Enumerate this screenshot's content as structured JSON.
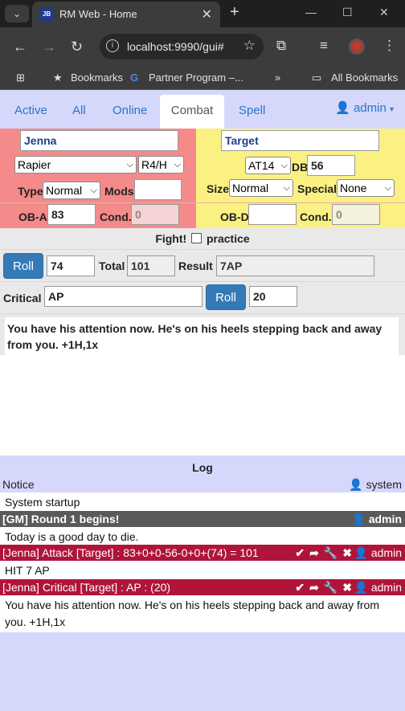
{
  "browser": {
    "tab_title": "RM Web  - Home",
    "favicon_text": "JB",
    "url": "localhost:9990/gui#",
    "bookmarks": [
      "Bookmarks",
      "Partner Program –...",
      "All Bookmarks"
    ]
  },
  "nav": {
    "tabs": [
      "Active",
      "All",
      "Online",
      "Combat",
      "Spell"
    ],
    "active_tab": "Combat",
    "user": "admin"
  },
  "combat": {
    "attacker_name": "Jenna",
    "target_name": "Target",
    "weapon": "Rapier",
    "weapon_mode": "R4/H",
    "armor": "AT14",
    "db_label": "DB",
    "db_value": "56",
    "type_label": "Type",
    "type_value": "Normal",
    "mods_label": "Mods",
    "mods_value": "",
    "size_label": "Size",
    "size_value": "Normal",
    "special_label": "Special",
    "special_value": "None",
    "oba_label": "OB-A",
    "oba_value": "83",
    "cond_label": "Cond.",
    "cond_a_value": "0",
    "obd_label": "OB-D",
    "obd_value": "",
    "cond_d_value": "0",
    "fight_label": "Fight!",
    "practice_label": "practice",
    "roll_label": "Roll",
    "roll_value": "74",
    "total_label": "Total",
    "total_value": "101",
    "result_label": "Result",
    "result_value": "7AP",
    "critical_label": "Critical",
    "critical_value": "AP",
    "crit_roll_label": "Roll",
    "crit_roll_value": "20",
    "result_text": "You have his attention now. He's on his heels stepping back and away from you. +1H,1x"
  },
  "log": {
    "title": "Log",
    "entries": [
      {
        "header": "Notice",
        "user": "system",
        "body": "System startup"
      },
      {
        "header": "[GM] Round 1 begins!",
        "user": "admin",
        "body": "Today is a good day to die."
      },
      {
        "header": "[Jenna] Attack [Target] : 83+0+0-56-0+0+(74) = 101",
        "user": "admin",
        "body": "HIT 7 AP"
      },
      {
        "header": "[Jenna] Critical [Target] : AP : (20)",
        "user": "admin",
        "body": "You have his attention now. He's on his heels stepping back and away from you. +1H,1x"
      }
    ]
  }
}
